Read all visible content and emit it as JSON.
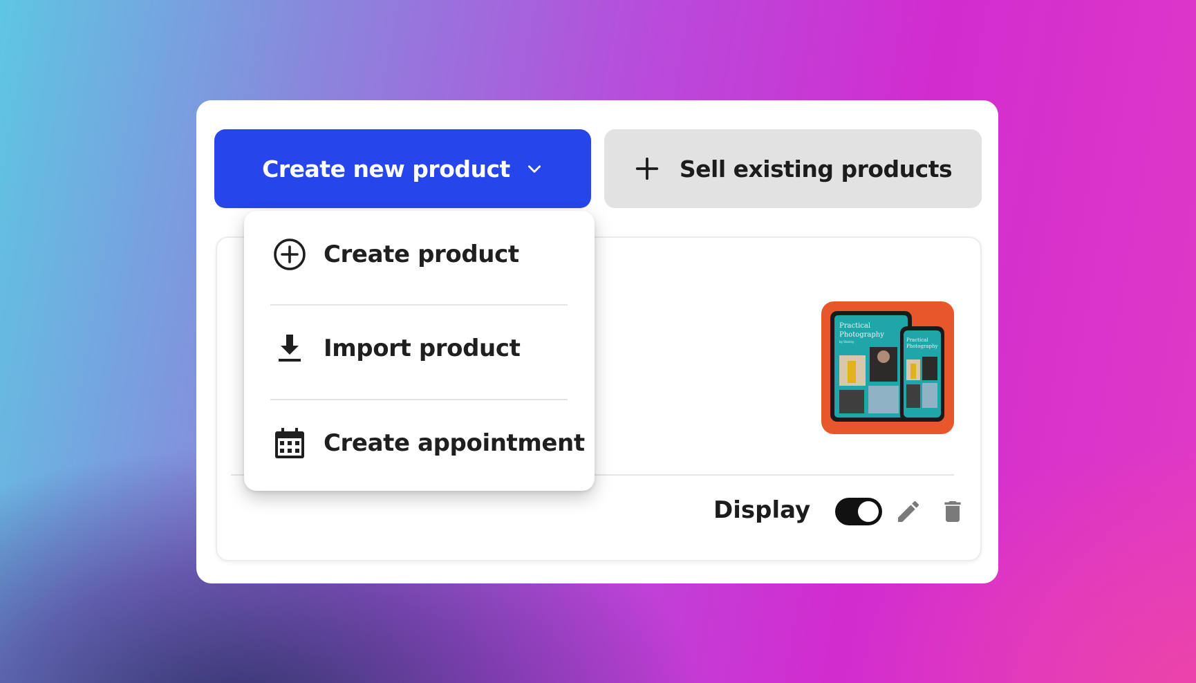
{
  "toolbar": {
    "create_new_label": "Create new product",
    "sell_existing_label": "Sell existing products"
  },
  "dropdown": {
    "items": [
      {
        "label": "Create product",
        "icon": "plus-circle-icon"
      },
      {
        "label": "Import product",
        "icon": "download-icon"
      },
      {
        "label": "Create appointment",
        "icon": "calendar-icon"
      }
    ]
  },
  "product_card": {
    "thumbnail_title": "Practical Photography",
    "thumbnail_byline": "by Stanley",
    "display_label": "Display",
    "display_enabled": true
  },
  "colors": {
    "primary": "#2645ea",
    "secondary_button": "#e2e2e2",
    "thumbnail_bg": "#e8562c",
    "screen_teal": "#1fa6a8"
  }
}
